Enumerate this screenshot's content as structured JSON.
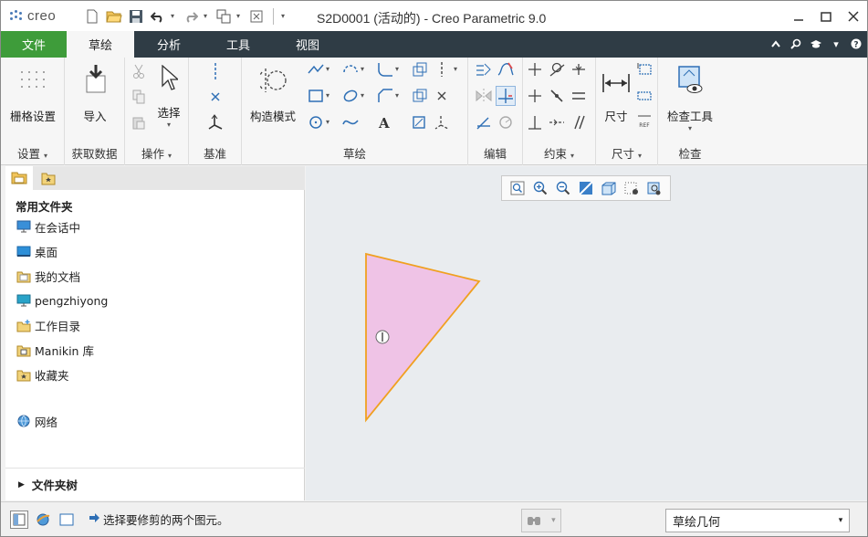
{
  "app": {
    "logo_text": "creo",
    "window_title": "S2D0001 (活动的) - Creo Parametric 9.0"
  },
  "colors": {
    "tab_bar": "#2f3c45",
    "file_tab": "#3e9c3a",
    "accent_blue": "#2e6fb5",
    "sketch_fill": "#efc3e6",
    "sketch_edge": "#f0a020"
  },
  "quick_access": {
    "icons": [
      "new-icon",
      "open-icon",
      "save-icon",
      "undo-icon",
      "redo-icon",
      "regenerate-icon",
      "close-window-icon",
      "customize-icon"
    ]
  },
  "tabs": [
    {
      "label": "文件"
    },
    {
      "label": "草绘"
    },
    {
      "label": "分析"
    },
    {
      "label": "工具"
    },
    {
      "label": "视图"
    }
  ],
  "ribbon": {
    "grid_settings_label": "栅格设置",
    "import_label": "导入",
    "select_label": "选择",
    "construction_mode_label": "构造模式",
    "dimension_label": "尺寸",
    "inspect_tools_label": "检查工具",
    "groups": {
      "settings": "设置",
      "get_data": "获取数据",
      "operations": "操作",
      "datum": "基准",
      "sketch": "草绘",
      "edit": "编辑",
      "constrain": "约束",
      "dimension": "尺寸",
      "inspect": "检查"
    }
  },
  "navigator": {
    "section_title": "常用文件夹",
    "items": [
      {
        "label": "在会话中",
        "icon": "monitor-icon"
      },
      {
        "label": "桌面",
        "icon": "desktop-icon"
      },
      {
        "label": "我的文档",
        "icon": "documents-icon"
      },
      {
        "label": "pengzhiyong",
        "icon": "user-folder-icon"
      },
      {
        "label": "工作目录",
        "icon": "working-directory-icon"
      },
      {
        "label": "Manikin 库",
        "icon": "library-icon"
      },
      {
        "label": "收藏夹",
        "icon": "favorites-icon"
      }
    ],
    "network_label": "网络",
    "folder_tree_label": "文件夹树"
  },
  "status": {
    "message": "选择要修剪的两个图元。",
    "filter_value": "草绘几何"
  }
}
